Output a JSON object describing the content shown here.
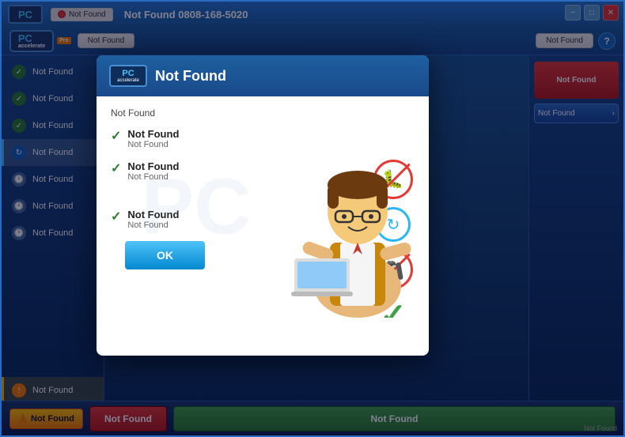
{
  "app": {
    "title": "PC Accelerate Pro",
    "logo_text": "PC",
    "logo_sub": "accelerate",
    "pro_label": "Pro"
  },
  "titlebar": {
    "status_label": "Not Found",
    "main_title": "Not Found  0808-168-5020",
    "minimize": "−",
    "maximize": "□",
    "close": "✕"
  },
  "secondarybar": {
    "nav_label": "Not Found",
    "not_found_btn": "Not Found",
    "help": "?"
  },
  "sidebar": {
    "items": [
      {
        "label": "Not Found",
        "icon": "check",
        "active": false
      },
      {
        "label": "Not Found",
        "icon": "check",
        "active": false
      },
      {
        "label": "Not Found",
        "icon": "check",
        "active": false
      },
      {
        "label": "Not Found",
        "icon": "sync",
        "active": true
      },
      {
        "label": "Not Found",
        "icon": "clock",
        "active": false
      },
      {
        "label": "Not Found",
        "icon": "clock",
        "active": false
      },
      {
        "label": "Not Found",
        "icon": "clock",
        "active": false
      }
    ]
  },
  "modal": {
    "title": "Not Found",
    "subtitle": "Not Found",
    "items": [
      {
        "label": "Not Found",
        "sublabel": "Not Found"
      },
      {
        "label": "Not Found",
        "sublabel": "Not Found"
      },
      {
        "label": "Not Found",
        "sublabel": "Not Found"
      }
    ],
    "ok_button": "OK"
  },
  "right_panel": {
    "red_btn": "Not Found",
    "nav_btn": "Not Found"
  },
  "bottom": {
    "warn_btn": "Not Found",
    "red_btn": "Not Found",
    "green_btn": "Not Found",
    "status": "Not Found"
  }
}
